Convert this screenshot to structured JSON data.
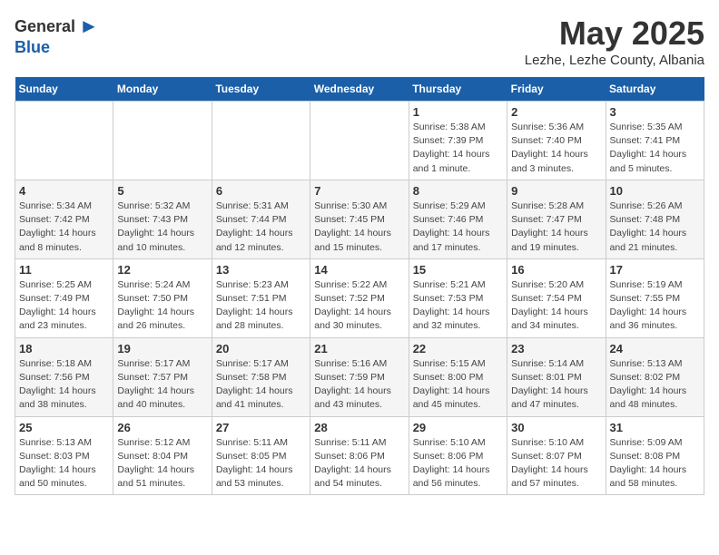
{
  "logo": {
    "general": "General",
    "blue": "Blue"
  },
  "title": {
    "month": "May 2025",
    "location": "Lezhe, Lezhe County, Albania"
  },
  "headers": [
    "Sunday",
    "Monday",
    "Tuesday",
    "Wednesday",
    "Thursday",
    "Friday",
    "Saturday"
  ],
  "weeks": [
    [
      {
        "day": "",
        "info": ""
      },
      {
        "day": "",
        "info": ""
      },
      {
        "day": "",
        "info": ""
      },
      {
        "day": "",
        "info": ""
      },
      {
        "day": "1",
        "info": "Sunrise: 5:38 AM\nSunset: 7:39 PM\nDaylight: 14 hours\nand 1 minute."
      },
      {
        "day": "2",
        "info": "Sunrise: 5:36 AM\nSunset: 7:40 PM\nDaylight: 14 hours\nand 3 minutes."
      },
      {
        "day": "3",
        "info": "Sunrise: 5:35 AM\nSunset: 7:41 PM\nDaylight: 14 hours\nand 5 minutes."
      }
    ],
    [
      {
        "day": "4",
        "info": "Sunrise: 5:34 AM\nSunset: 7:42 PM\nDaylight: 14 hours\nand 8 minutes."
      },
      {
        "day": "5",
        "info": "Sunrise: 5:32 AM\nSunset: 7:43 PM\nDaylight: 14 hours\nand 10 minutes."
      },
      {
        "day": "6",
        "info": "Sunrise: 5:31 AM\nSunset: 7:44 PM\nDaylight: 14 hours\nand 12 minutes."
      },
      {
        "day": "7",
        "info": "Sunrise: 5:30 AM\nSunset: 7:45 PM\nDaylight: 14 hours\nand 15 minutes."
      },
      {
        "day": "8",
        "info": "Sunrise: 5:29 AM\nSunset: 7:46 PM\nDaylight: 14 hours\nand 17 minutes."
      },
      {
        "day": "9",
        "info": "Sunrise: 5:28 AM\nSunset: 7:47 PM\nDaylight: 14 hours\nand 19 minutes."
      },
      {
        "day": "10",
        "info": "Sunrise: 5:26 AM\nSunset: 7:48 PM\nDaylight: 14 hours\nand 21 minutes."
      }
    ],
    [
      {
        "day": "11",
        "info": "Sunrise: 5:25 AM\nSunset: 7:49 PM\nDaylight: 14 hours\nand 23 minutes."
      },
      {
        "day": "12",
        "info": "Sunrise: 5:24 AM\nSunset: 7:50 PM\nDaylight: 14 hours\nand 26 minutes."
      },
      {
        "day": "13",
        "info": "Sunrise: 5:23 AM\nSunset: 7:51 PM\nDaylight: 14 hours\nand 28 minutes."
      },
      {
        "day": "14",
        "info": "Sunrise: 5:22 AM\nSunset: 7:52 PM\nDaylight: 14 hours\nand 30 minutes."
      },
      {
        "day": "15",
        "info": "Sunrise: 5:21 AM\nSunset: 7:53 PM\nDaylight: 14 hours\nand 32 minutes."
      },
      {
        "day": "16",
        "info": "Sunrise: 5:20 AM\nSunset: 7:54 PM\nDaylight: 14 hours\nand 34 minutes."
      },
      {
        "day": "17",
        "info": "Sunrise: 5:19 AM\nSunset: 7:55 PM\nDaylight: 14 hours\nand 36 minutes."
      }
    ],
    [
      {
        "day": "18",
        "info": "Sunrise: 5:18 AM\nSunset: 7:56 PM\nDaylight: 14 hours\nand 38 minutes."
      },
      {
        "day": "19",
        "info": "Sunrise: 5:17 AM\nSunset: 7:57 PM\nDaylight: 14 hours\nand 40 minutes."
      },
      {
        "day": "20",
        "info": "Sunrise: 5:17 AM\nSunset: 7:58 PM\nDaylight: 14 hours\nand 41 minutes."
      },
      {
        "day": "21",
        "info": "Sunrise: 5:16 AM\nSunset: 7:59 PM\nDaylight: 14 hours\nand 43 minutes."
      },
      {
        "day": "22",
        "info": "Sunrise: 5:15 AM\nSunset: 8:00 PM\nDaylight: 14 hours\nand 45 minutes."
      },
      {
        "day": "23",
        "info": "Sunrise: 5:14 AM\nSunset: 8:01 PM\nDaylight: 14 hours\nand 47 minutes."
      },
      {
        "day": "24",
        "info": "Sunrise: 5:13 AM\nSunset: 8:02 PM\nDaylight: 14 hours\nand 48 minutes."
      }
    ],
    [
      {
        "day": "25",
        "info": "Sunrise: 5:13 AM\nSunset: 8:03 PM\nDaylight: 14 hours\nand 50 minutes."
      },
      {
        "day": "26",
        "info": "Sunrise: 5:12 AM\nSunset: 8:04 PM\nDaylight: 14 hours\nand 51 minutes."
      },
      {
        "day": "27",
        "info": "Sunrise: 5:11 AM\nSunset: 8:05 PM\nDaylight: 14 hours\nand 53 minutes."
      },
      {
        "day": "28",
        "info": "Sunrise: 5:11 AM\nSunset: 8:06 PM\nDaylight: 14 hours\nand 54 minutes."
      },
      {
        "day": "29",
        "info": "Sunrise: 5:10 AM\nSunset: 8:06 PM\nDaylight: 14 hours\nand 56 minutes."
      },
      {
        "day": "30",
        "info": "Sunrise: 5:10 AM\nSunset: 8:07 PM\nDaylight: 14 hours\nand 57 minutes."
      },
      {
        "day": "31",
        "info": "Sunrise: 5:09 AM\nSunset: 8:08 PM\nDaylight: 14 hours\nand 58 minutes."
      }
    ]
  ]
}
